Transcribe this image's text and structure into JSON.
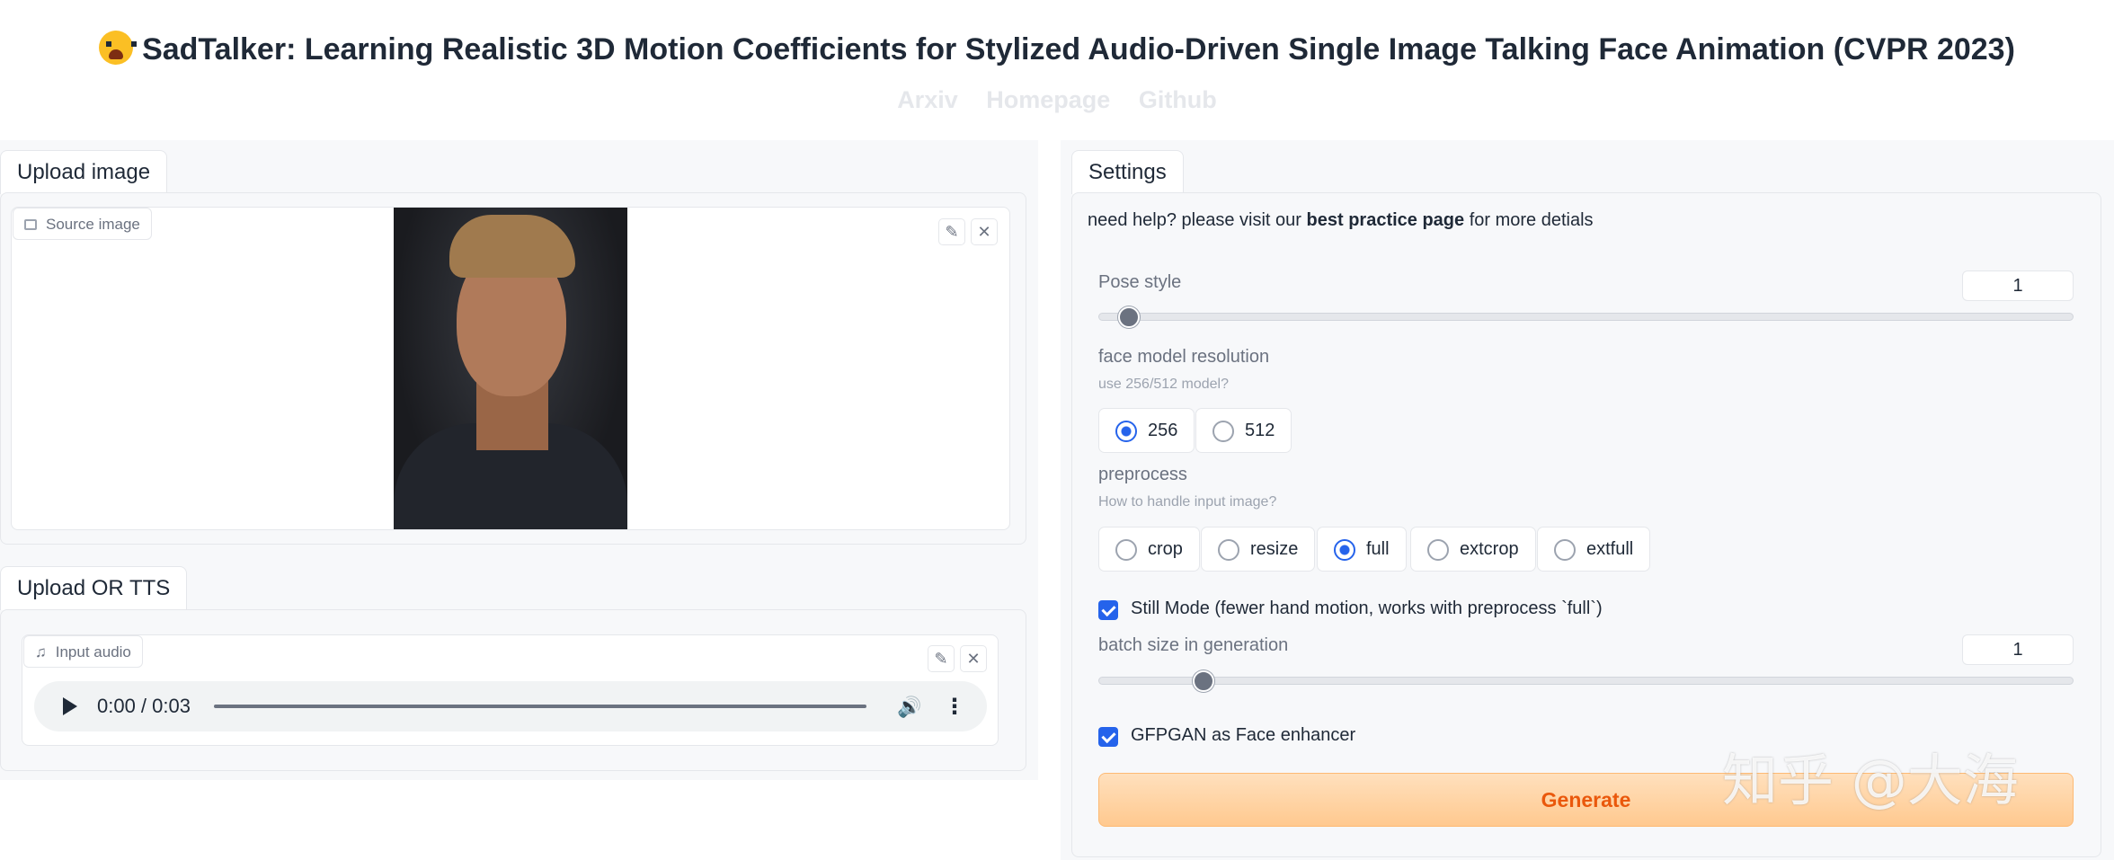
{
  "header": {
    "title": "SadTalker: Learning Realistic 3D Motion Coefficients for Stylized Audio-Driven Single Image Talking Face Animation (CVPR 2023)",
    "links": [
      "Arxiv",
      "Homepage",
      "Github"
    ]
  },
  "left": {
    "upload_tab": "Upload image",
    "source_label": "Source image",
    "audio_tab": "Upload OR TTS",
    "audio_label": "Input audio",
    "audio_time": "0:00 / 0:03"
  },
  "right": {
    "settings_tab": "Settings",
    "help_prefix": "need help? please visit our",
    "help_link": "best practice page",
    "help_suffix": "for more detials",
    "pose_style": {
      "label": "Pose style",
      "value": "1",
      "fraction": 0.0
    },
    "face_model": {
      "label": "face model resolution",
      "info": "use 256/512 model?",
      "options": [
        "256",
        "512"
      ],
      "selected": "256"
    },
    "preprocess": {
      "label": "preprocess",
      "info": "How to handle input image?",
      "options": [
        "crop",
        "resize",
        "full",
        "extcrop",
        "extfull"
      ],
      "selected": "full"
    },
    "still_mode": "Still Mode (fewer hand motion, works with preprocess `full`)",
    "batch_size": {
      "label": "batch size in generation",
      "value": "1",
      "fraction": 0.1
    },
    "gfpgan": "GFPGAN as Face enhancer",
    "generate": "Generate"
  },
  "watermark": "知乎 @大海",
  "colors": {
    "accent": "#2563eb",
    "generate_text": "#ea580c",
    "generate_bg": "#ffd2a3"
  },
  "icons": [
    "crying-face-icon",
    "image-icon",
    "edit-icon",
    "close-icon",
    "music-icon",
    "play-icon",
    "volume-icon",
    "more-icon"
  ]
}
